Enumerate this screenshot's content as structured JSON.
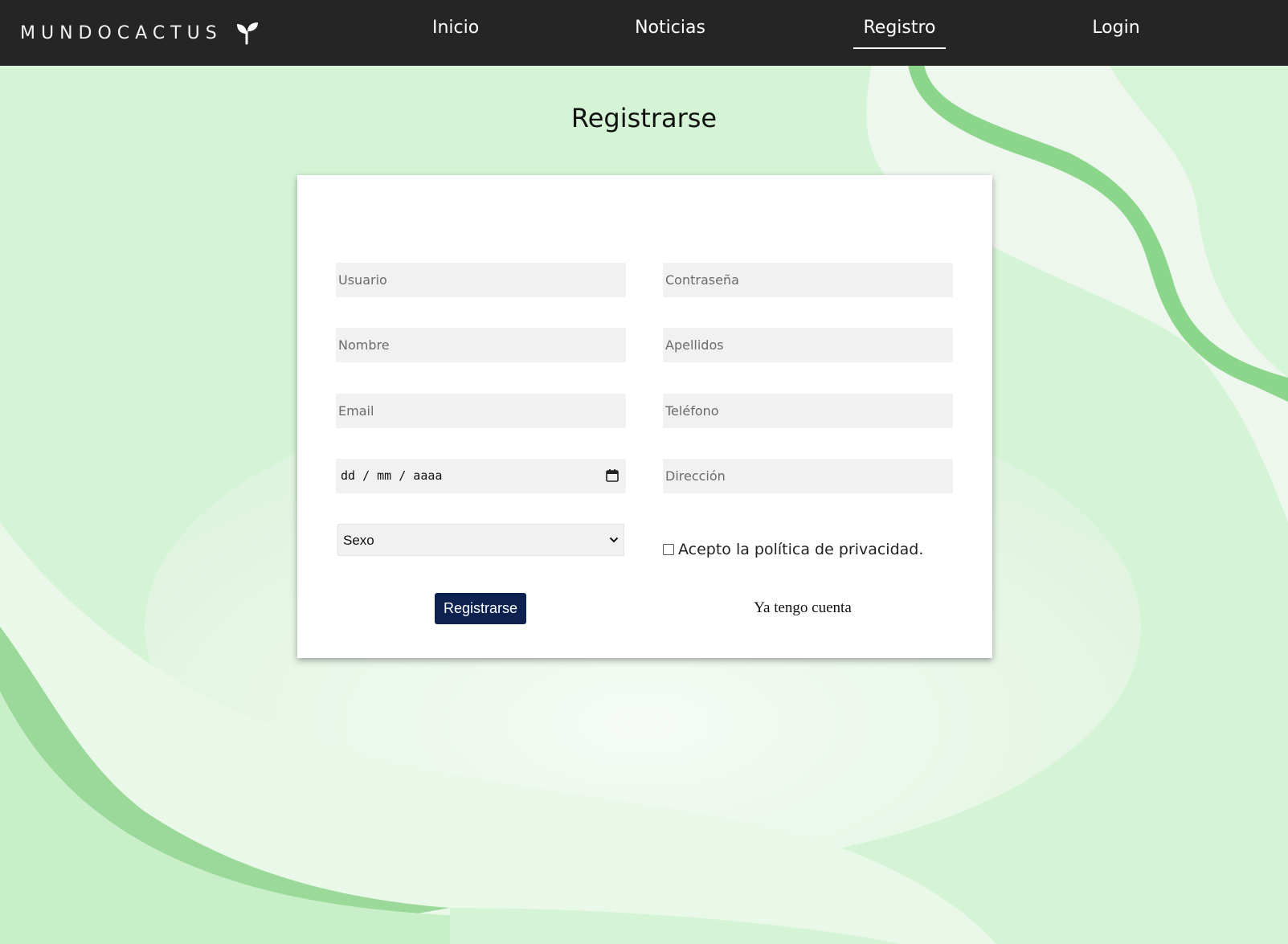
{
  "colors": {
    "navbar_background": "#252525",
    "page_background": "#d6f5d6",
    "accent_green": "#7fcf7f",
    "submit_button": "#0e2251"
  },
  "brand": {
    "name": "MUNDOCACTUS",
    "icon": "sprout-icon"
  },
  "nav": {
    "items": [
      {
        "label": "Inicio"
      },
      {
        "label": "Noticias"
      },
      {
        "label": "Registro",
        "active": true
      },
      {
        "label": "Login"
      }
    ]
  },
  "page": {
    "title": "Registrarse"
  },
  "form": {
    "fields": {
      "usuario": "Usuario",
      "contrasena": "Contraseña",
      "nombre": "Nombre",
      "apellidos": "Apellidos",
      "email": "Email",
      "telefono": "Teléfono",
      "direccion": "Dirección"
    },
    "date": {
      "placeholder": "dd / mm / aaaa",
      "icon": "calendar-icon"
    },
    "sexo": {
      "selected": "Sexo",
      "icon": "chevron-down-icon"
    },
    "privacy": {
      "label": "Acepto la política de privacidad.",
      "checked": false
    },
    "submit_label": "Registrarse",
    "login_link": "Ya tengo cuenta"
  }
}
